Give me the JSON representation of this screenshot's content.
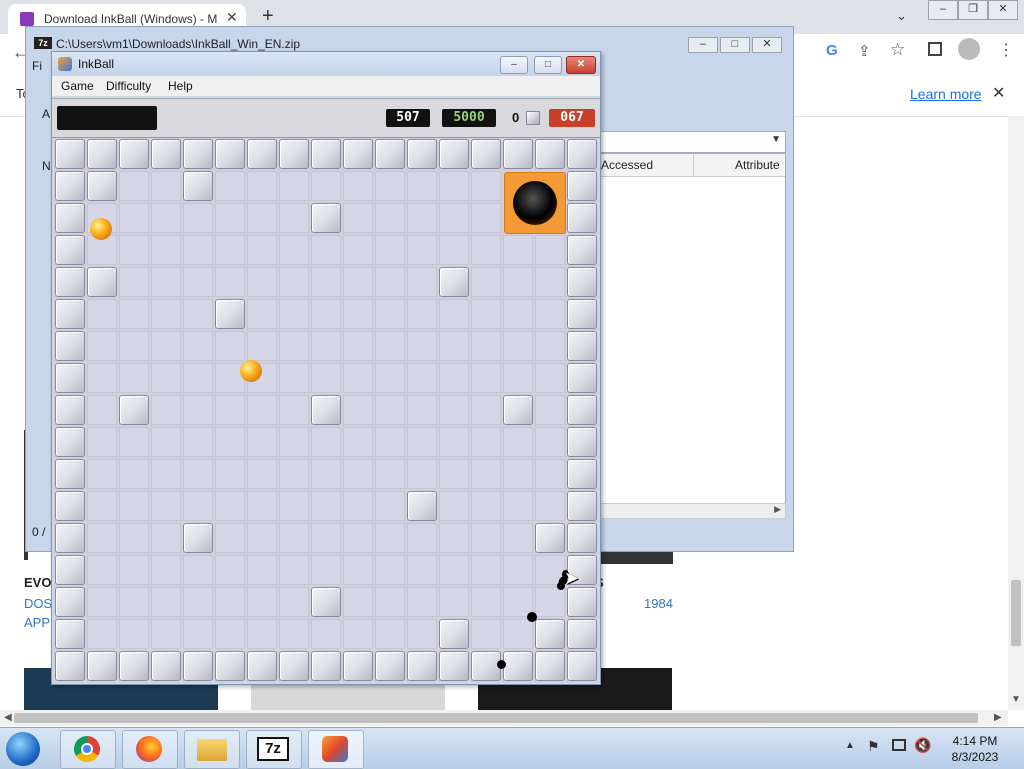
{
  "chrome": {
    "tab_title": "Download InkBall (Windows) - M",
    "learn_more": "Learn more",
    "toolbar_partial_label": "To"
  },
  "sevenzip": {
    "path": "C:\\Users\\vm1\\Downloads\\InkBall_Win_EN.zip",
    "col_accessed": "Accessed",
    "col_attributes": "Attribute",
    "status_left": "0 /",
    "menu_partial": "Fi",
    "row_partial_a": "A",
    "row_partial_n": "N"
  },
  "inkball": {
    "title": "InkBall",
    "menu": [
      "Game",
      "Difficulty",
      "Help"
    ],
    "score": "507",
    "target": "5000",
    "balls_left": "0",
    "timer": "067",
    "colors": {
      "score_bg": "#111111",
      "target_bg": "#111111",
      "target_fg": "#9ad27a",
      "timer_bg": "#c8402a",
      "ball": "#ffb01f",
      "hole": "#f39a36"
    },
    "grid_size": 17,
    "hole_color": "orange",
    "ball_count": 2
  },
  "webpage": {
    "heading_partial": "EVO",
    "platform_1": "DOS,",
    "platform_2": "APPL",
    "year": "1984",
    "letter_s": "S"
  },
  "taskbar": {
    "time": "4:14 PM",
    "date": "8/3/2023",
    "apps": [
      "Chrome",
      "Firefox",
      "File Explorer",
      "7-Zip",
      "InkBall"
    ]
  }
}
